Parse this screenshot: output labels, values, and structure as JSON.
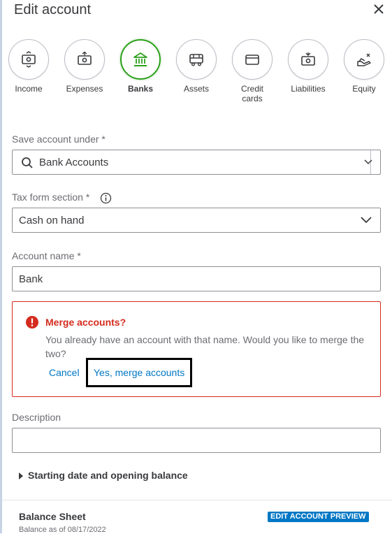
{
  "header": {
    "title": "Edit account"
  },
  "categories": [
    {
      "label": "Income",
      "icon": "money-icon",
      "selected": false
    },
    {
      "label": "Expenses",
      "icon": "money-out-icon",
      "selected": false
    },
    {
      "label": "Banks",
      "icon": "bank-icon",
      "selected": true
    },
    {
      "label": "Assets",
      "icon": "truck-icon",
      "selected": false
    },
    {
      "label": "Credit cards",
      "icon": "credit-card-icon",
      "selected": false
    },
    {
      "label": "Liabilities",
      "icon": "money-liability-icon",
      "selected": false
    },
    {
      "label": "Equity",
      "icon": "hand-money-icon",
      "selected": false
    }
  ],
  "form": {
    "save_under_label": "Save account under *",
    "save_under_value": "Bank Accounts",
    "tax_form_label": "Tax form section *",
    "tax_form_value": "Cash on hand",
    "account_name_label": "Account name *",
    "account_name_value": "Bank",
    "description_label": "Description",
    "description_value": ""
  },
  "alert": {
    "title": "Merge accounts?",
    "message": "You already have an account with that name. Would you like to merge the two?",
    "cancel_label": "Cancel",
    "confirm_label": "Yes, merge accounts"
  },
  "disclosure": {
    "label": "Starting date and opening balance"
  },
  "preview": {
    "title": "Balance Sheet",
    "subtitle": "Balance as of 08/17/2022",
    "badge": "EDIT ACCOUNT PREVIEW"
  },
  "colors": {
    "accent": "#0077c5",
    "selected": "#2ca01c",
    "error": "#d52b1e"
  }
}
